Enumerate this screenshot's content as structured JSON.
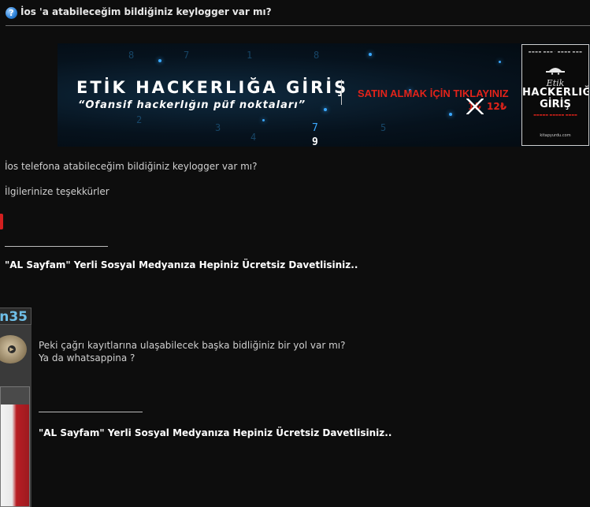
{
  "thread": {
    "icon": "question-icon",
    "title": "İos 'a atabileceğim bildiğiniz keylogger var mı?"
  },
  "banner": {
    "title": "ETİK HACKERLIĞA GİRİŞ",
    "subtitle": "“Ofansif hackerlığın püf noktaları”",
    "cta": "SATIN ALMAK İÇİN TIKLAYINIZ",
    "price_old": "1₺",
    "price_new": "12₺",
    "digit_1": "7",
    "digit_2": "9",
    "book": {
      "script": "Etik",
      "title_line1": "HACKERLIĞA",
      "title_line2": "GİRİŞ",
      "footer": "kitapyurdu.com"
    }
  },
  "post1": {
    "line1": "İos telefona atabileceğim bildiğiniz keylogger var mı?",
    "line2": "İlgilerinize teşekkürler",
    "signature": "\"AL Sayfam\" Yerli Sosyal Medyanıza Hepiniz Ücretsiz Davetlisiniz.."
  },
  "post2": {
    "avatar_tag": "n35",
    "line1": "Peki çağrı kayıtlarına ulaşabilecek başka bidliğiniz bir yol var mı?",
    "line2": "Ya da whatsappina ?",
    "signature": "\"AL Sayfam\" Yerli Sosyal Medyanıza Hepiniz Ücretsiz Davetlisiniz.."
  },
  "colors": {
    "background": "#0d0d0d",
    "accent_red": "#e2231a",
    "accent_blue": "#3aa8ff"
  }
}
